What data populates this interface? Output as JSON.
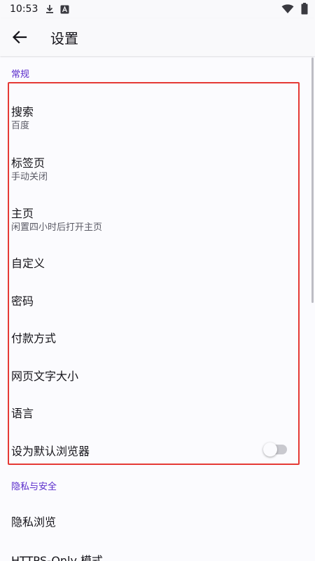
{
  "status_bar": {
    "time": "10:53",
    "icons": [
      "download-icon",
      "notification-a-icon",
      "wifi-icon",
      "battery-icon"
    ]
  },
  "app_bar": {
    "back_icon": "arrow-back-icon",
    "title": "设置"
  },
  "sections": {
    "general": {
      "header": "常规",
      "items": [
        {
          "title": "搜索",
          "summary": "百度"
        },
        {
          "title": "标签页",
          "summary": "手动关闭"
        },
        {
          "title": "主页",
          "summary": "闲置四小时后打开主页"
        },
        {
          "title": "自定义"
        },
        {
          "title": "密码"
        },
        {
          "title": "付款方式"
        },
        {
          "title": "网页文字大小"
        },
        {
          "title": "语言"
        },
        {
          "title": "设为默认浏览器",
          "toggle_on": false
        }
      ]
    },
    "privacy": {
      "header": "隐私与安全",
      "items": [
        {
          "title": "隐私浏览"
        },
        {
          "title": "HTTPS-Only 模式"
        }
      ]
    }
  },
  "colors": {
    "accent": "#592acb",
    "highlight": "#e53935",
    "background": "#fbfbfe"
  }
}
